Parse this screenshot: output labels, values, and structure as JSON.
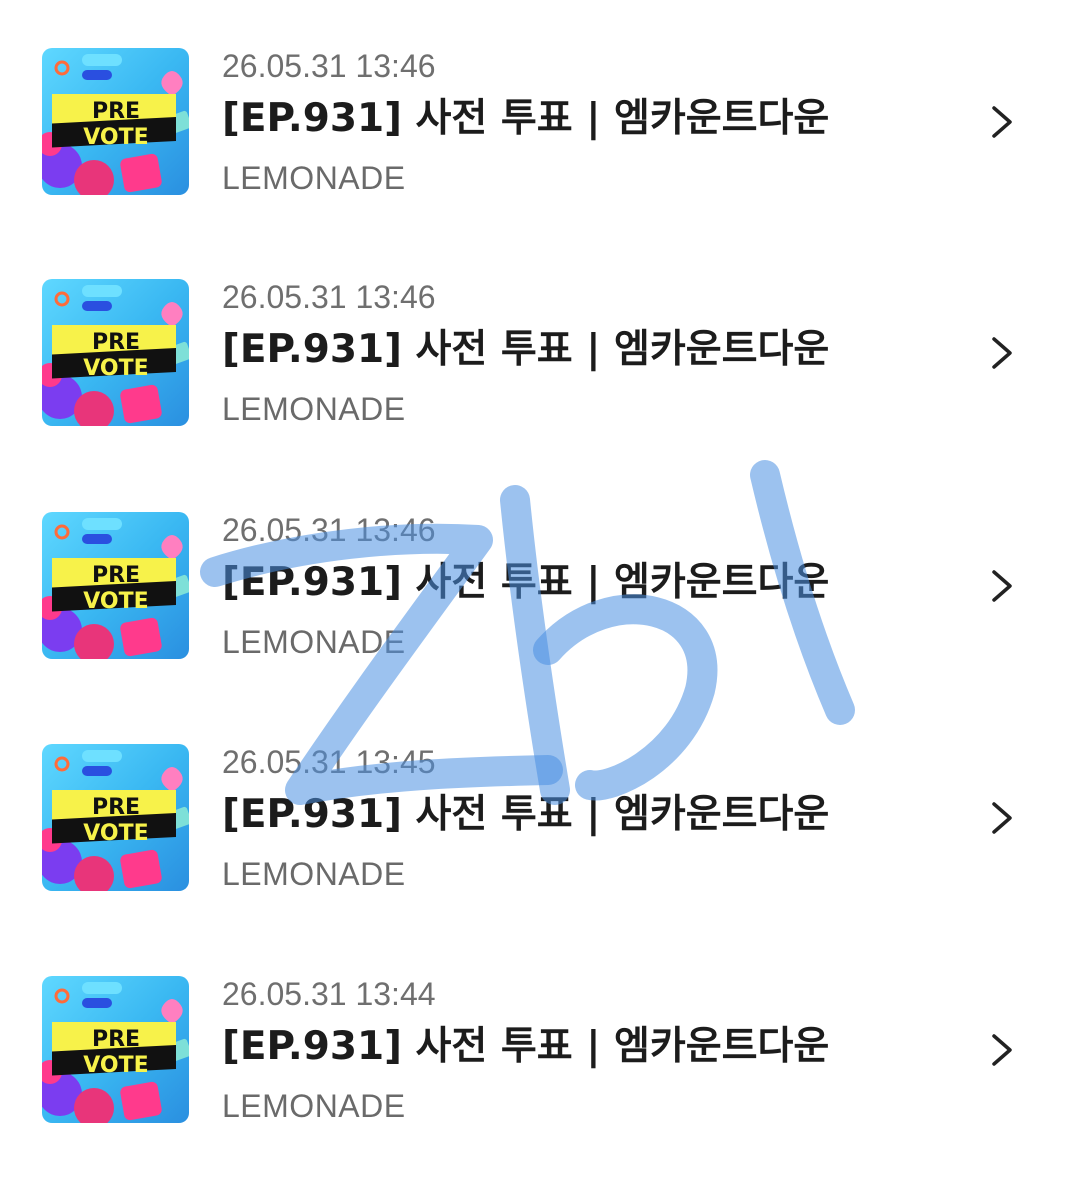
{
  "items": [
    {
      "date": "26.05.31 13:46",
      "title": "[EP.931] 사전 투표 | 엠카운트다운",
      "channel": "LEMONADE",
      "thumb_text": [
        "PRE",
        "VOTE"
      ]
    },
    {
      "date": "26.05.31 13:46",
      "title": "[EP.931] 사전 투표 | 엠카운트다운",
      "channel": "LEMONADE",
      "thumb_text": [
        "PRE",
        "VOTE"
      ]
    },
    {
      "date": "26.05.31 13:46",
      "title": "[EP.931] 사전 투표 | 엠카운트다운",
      "channel": "LEMONADE",
      "thumb_text": [
        "PRE",
        "VOTE"
      ]
    },
    {
      "date": "26.05.31 13:45",
      "title": "[EP.931] 사전 투표 | 엠카운트다운",
      "channel": "LEMONADE",
      "thumb_text": [
        "PRE",
        "VOTE"
      ]
    },
    {
      "date": "26.05.31 13:44",
      "title": "[EP.931] 사전 투표 | 엠카운트다운",
      "channel": "LEMONADE",
      "thumb_text": [
        "PRE",
        "VOTE"
      ]
    }
  ],
  "watermark": "Zbl",
  "icons": {
    "row_action": "chevron-right-icon",
    "thumbnail": "pre-vote-thumbnail"
  },
  "colors": {
    "title": "#1c1c1c",
    "meta": "#6f6f6f",
    "watermark": "#4a90e2",
    "thumb_bg": "#3ec8f0",
    "thumb_banner": "#f7f24a"
  }
}
